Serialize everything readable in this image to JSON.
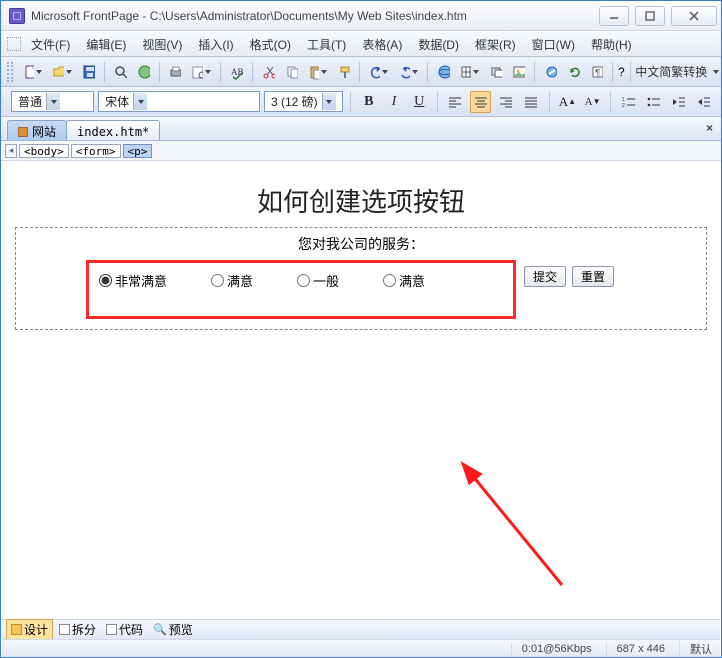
{
  "title": "Microsoft FrontPage - C:\\Users\\Administrator\\Documents\\My Web Sites\\index.htm",
  "menu": {
    "file": "文件(F)",
    "edit": "编辑(E)",
    "view": "视图(V)",
    "insert": "插入(I)",
    "format": "格式(O)",
    "tools": "工具(T)",
    "table": "表格(A)",
    "data": "数据(D)",
    "frames": "框架(R)",
    "window": "窗口(W)",
    "help": "帮助(H)"
  },
  "toolbar2": {
    "cn_convert": "中文简繁转换"
  },
  "format_bar": {
    "style": "普通",
    "font": "宋体",
    "size": "3 (12 磅)"
  },
  "tabs": {
    "site": "网站",
    "file": "index.htm*"
  },
  "crumbs": {
    "body": "<body>",
    "form": "<form>",
    "p": "<p>"
  },
  "doc": {
    "heading": "如何创建选项按钮",
    "prompt": "您对我公司的服务：",
    "options": [
      "非常满意",
      "满意",
      "一般",
      "满意"
    ],
    "submit": "提交",
    "reset": "重置"
  },
  "views": {
    "design": "设计",
    "split": "拆分",
    "code": "代码",
    "preview": "预览"
  },
  "status": {
    "time": "0:01@56Kbps",
    "dims": "687 x 446",
    "mode": "默认"
  }
}
